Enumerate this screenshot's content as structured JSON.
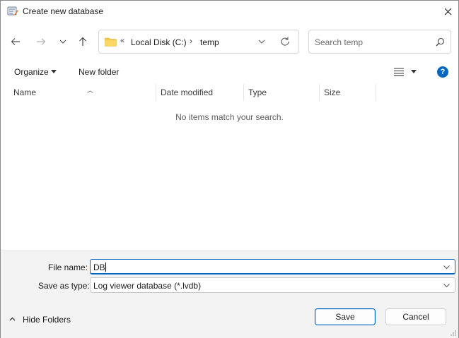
{
  "window": {
    "title": "Create new database",
    "icons": {
      "app": "database-edit-icon",
      "close": "close-icon"
    }
  },
  "nav": {
    "back": "back-arrow-icon",
    "forward": "forward-arrow-icon",
    "recent": "chevron-down-icon",
    "up": "up-arrow-icon"
  },
  "address": {
    "overflow": "«",
    "crumbs": [
      "Local Disk (C:)",
      "temp"
    ],
    "separator": "›"
  },
  "search": {
    "placeholder": "Search temp"
  },
  "toolbar": {
    "organize": "Organize",
    "new_folder": "New folder",
    "help": "?"
  },
  "columns": [
    "Name",
    "Date modified",
    "Type",
    "Size"
  ],
  "list": {
    "empty_message": "No items match your search."
  },
  "form": {
    "file_name_label": "File name:",
    "file_name_value": "DB",
    "save_type_label": "Save as type:",
    "save_type_value": "Log viewer database (*.lvdb)"
  },
  "footer": {
    "hide_folders": "Hide Folders",
    "save": "Save",
    "cancel": "Cancel"
  },
  "colors": {
    "accent": "#0067c0",
    "folder": "#f6c94b"
  }
}
